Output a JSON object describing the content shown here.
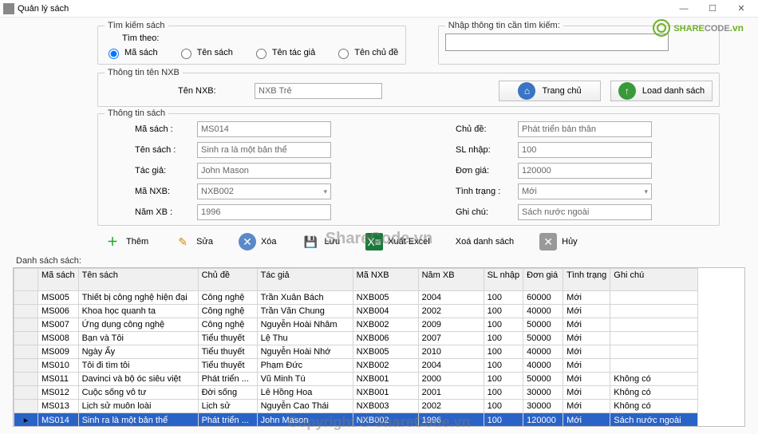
{
  "window": {
    "title": "Quản lý sách"
  },
  "watermark": {
    "top": "SHARECODE.vn",
    "center": "ShareCode.vn",
    "bottom": "Copyright © ShareCode.vn"
  },
  "search": {
    "legend": "Tìm kiếm sách",
    "tim_theo_label": "Tìm theo:",
    "options": {
      "masach": "Mã sách",
      "tensach": "Tên sách",
      "tacgia": "Tên tác giả",
      "chude": "Tên chủ đề"
    },
    "input_label": "Nhập thông tin cần tìm kiếm:",
    "input_value": ""
  },
  "nxb": {
    "legend": "Thông tin tên NXB",
    "ten_label": "Tên NXB:",
    "ten_value": "NXB Trẻ",
    "trangchu": "Trang chủ",
    "loadds": "Load danh sách"
  },
  "info": {
    "legend": "Thông tin sách",
    "masach_label": "Mã sách :",
    "masach": "MS014",
    "tensach_label": "Tên sách :",
    "tensach": "Sinh ra là một bản thể",
    "tacgia_label": "Tác giả:",
    "tacgia": "John Mason",
    "manxb_label": "Mã NXB:",
    "manxb": "NXB002",
    "namxb_label": "Năm XB :",
    "namxb": "1996",
    "chude_label": "Chủ đề:",
    "chude": "Phát triển bản thân",
    "slnhap_label": "SL nhập:",
    "slnhap": "100",
    "dongia_label": "Đơn giá:",
    "dongia": "120000",
    "tinhtrang_label": "Tình trạng :",
    "tinhtrang": "Mới",
    "ghichu_label": "Ghi chú:",
    "ghichu": "Sách nước ngoài"
  },
  "toolbar": {
    "them": "Thêm",
    "sua": "Sửa",
    "xoa": "Xóa",
    "luu": "Lưu",
    "excel": "Xuất Excel",
    "xoads": "Xoá danh sách",
    "huy": "Hủy"
  },
  "list_label": "Danh sách sách:",
  "columns": {
    "masach": "Mã sách",
    "tensach": "Tên sách",
    "chude": "Chủ đề",
    "tacgia": "Tác giả",
    "manxb": "Mã NXB",
    "namxb": "Năm XB",
    "slnhap": "SL nhập",
    "dongia": "Đơn giá",
    "tinhtrang": "Tình trạng",
    "ghichu": "Ghi chú"
  },
  "rows": [
    {
      "masach": "MS005",
      "tensach": "Thiết bị công nghệ hiện đại",
      "chude": "Công nghệ",
      "tacgia": "Trần Xuân Bách",
      "manxb": "NXB005",
      "namxb": "2004",
      "slnhap": "100",
      "dongia": "60000",
      "tinhtrang": "Mới",
      "ghichu": ""
    },
    {
      "masach": "MS006",
      "tensach": "Khoa học quanh ta",
      "chude": "Công nghệ",
      "tacgia": "Trần Văn Chung",
      "manxb": "NXB004",
      "namxb": "2002",
      "slnhap": "100",
      "dongia": "40000",
      "tinhtrang": "Mới",
      "ghichu": ""
    },
    {
      "masach": "MS007",
      "tensach": "Ứng dụng công nghệ",
      "chude": "Công nghệ",
      "tacgia": "Nguyễn Hoài Nhâm",
      "manxb": "NXB002",
      "namxb": "2009",
      "slnhap": "100",
      "dongia": "50000",
      "tinhtrang": "Mới",
      "ghichu": ""
    },
    {
      "masach": "MS008",
      "tensach": "Bạn và Tôi",
      "chude": "Tiểu thuyết",
      "tacgia": "Lệ Thu",
      "manxb": "NXB006",
      "namxb": "2007",
      "slnhap": "100",
      "dongia": "50000",
      "tinhtrang": "Mới",
      "ghichu": ""
    },
    {
      "masach": "MS009",
      "tensach": "Ngày Ấy",
      "chude": "Tiểu thuyết",
      "tacgia": "Nguyễn Hoài Nhớ",
      "manxb": "NXB005",
      "namxb": "2010",
      "slnhap": "100",
      "dongia": "40000",
      "tinhtrang": "Mới",
      "ghichu": ""
    },
    {
      "masach": "MS010",
      "tensach": "Tôi đi tìm tôi",
      "chude": "Tiểu thuyết",
      "tacgia": "Phạm Đức",
      "manxb": "NXB002",
      "namxb": "2004",
      "slnhap": "100",
      "dongia": "40000",
      "tinhtrang": "Mới",
      "ghichu": ""
    },
    {
      "masach": "MS011",
      "tensach": "Davinci và bộ óc siêu việt",
      "chude": "Phát triển ...",
      "tacgia": "Vũ Minh Tú",
      "manxb": "NXB001",
      "namxb": "2000",
      "slnhap": "100",
      "dongia": "50000",
      "tinhtrang": "Mới",
      "ghichu": "Không có"
    },
    {
      "masach": "MS012",
      "tensach": "Cuộc sống vô tư",
      "chude": "Đời sống",
      "tacgia": "Lê Hồng Hoa",
      "manxb": "NXB001",
      "namxb": "2001",
      "slnhap": "100",
      "dongia": "30000",
      "tinhtrang": "Mới",
      "ghichu": "Không có"
    },
    {
      "masach": "MS013",
      "tensach": "Lịch sử muôn loài",
      "chude": "Lịch sử",
      "tacgia": "Nguyễn Cao Thái",
      "manxb": "NXB003",
      "namxb": "2002",
      "slnhap": "100",
      "dongia": "30000",
      "tinhtrang": "Mới",
      "ghichu": "Không có"
    },
    {
      "masach": "MS014",
      "tensach": "Sinh ra là một bản thể",
      "chude": "Phát triển ...",
      "tacgia": "John Mason",
      "manxb": "NXB002",
      "namxb": "1996",
      "slnhap": "100",
      "dongia": "120000",
      "tinhtrang": "Mới",
      "ghichu": "Sách nước ngoài"
    }
  ],
  "selected_index": 9
}
